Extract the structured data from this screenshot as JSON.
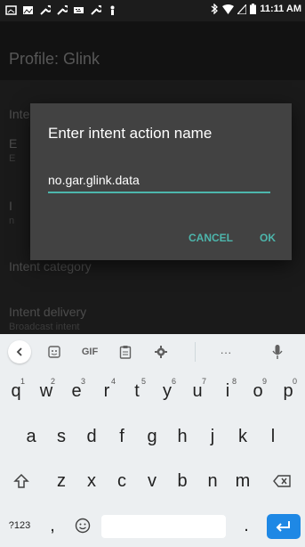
{
  "status_bar": {
    "time": "11:11 AM"
  },
  "app_bar": {
    "title": "Profile: Glink"
  },
  "settings": {
    "items": [
      {
        "title": "Intent",
        "subtitle": ""
      },
      {
        "title": "E",
        "subtitle": "E"
      },
      {
        "title": "I",
        "subtitle": "n"
      },
      {
        "title": "Intent category",
        "subtitle": ""
      },
      {
        "title": "Intent delivery",
        "subtitle": "Broadcast intent"
      }
    ]
  },
  "dialog": {
    "title": "Enter intent action name",
    "input_value": "no.gar.glink.data",
    "cancel_label": "CANCEL",
    "ok_label": "OK",
    "accent_color": "#4db6ac"
  },
  "keyboard": {
    "suggestion_gif": "GIF",
    "suggestion_more": "···",
    "row1": [
      {
        "label": "q",
        "hint": "1"
      },
      {
        "label": "w",
        "hint": "2"
      },
      {
        "label": "e",
        "hint": "3"
      },
      {
        "label": "r",
        "hint": "4"
      },
      {
        "label": "t",
        "hint": "5"
      },
      {
        "label": "y",
        "hint": "6"
      },
      {
        "label": "u",
        "hint": "7"
      },
      {
        "label": "i",
        "hint": "8"
      },
      {
        "label": "o",
        "hint": "9"
      },
      {
        "label": "p",
        "hint": "0"
      }
    ],
    "row2": [
      "a",
      "s",
      "d",
      "f",
      "g",
      "h",
      "j",
      "k",
      "l"
    ],
    "row3": [
      "z",
      "x",
      "c",
      "v",
      "b",
      "n",
      "m"
    ],
    "symbols_label": "?123",
    "comma": ",",
    "period": ".",
    "enter_color": "#1e88e5"
  }
}
